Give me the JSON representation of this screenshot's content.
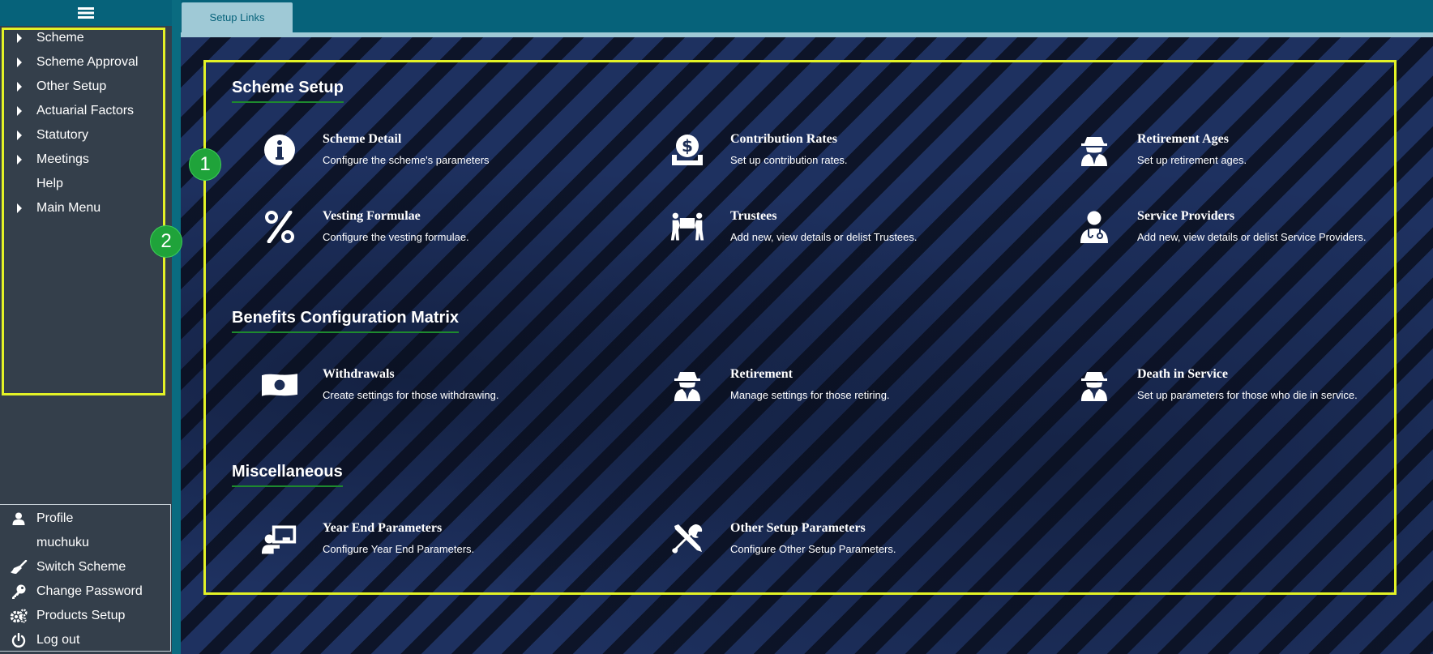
{
  "sidebar": {
    "menu_icon": "hamburger-icon",
    "items": [
      {
        "label": "Scheme",
        "expandable": true
      },
      {
        "label": "Scheme Approval",
        "expandable": true
      },
      {
        "label": "Other Setup",
        "expandable": true
      },
      {
        "label": "Actuarial Factors",
        "expandable": true
      },
      {
        "label": "Statutory",
        "expandable": true
      },
      {
        "label": "Meetings",
        "expandable": true
      },
      {
        "label": "Help",
        "expandable": false
      },
      {
        "label": "Main Menu",
        "expandable": true
      }
    ],
    "user_menu": [
      {
        "label": "Profile",
        "icon": "user-icon"
      },
      {
        "label": "muchuku",
        "icon": ""
      },
      {
        "label": "Switch Scheme",
        "icon": "broom-icon"
      },
      {
        "label": "Change Password",
        "icon": "key-icon"
      },
      {
        "label": "Products Setup",
        "icon": "gears-icon"
      },
      {
        "label": "Log out",
        "icon": "power-icon"
      }
    ]
  },
  "tabs": [
    {
      "label": "Setup Links",
      "active": true
    }
  ],
  "sections": [
    {
      "title": "Scheme Setup",
      "items": [
        {
          "title": "Scheme Detail",
          "description": "Configure the scheme's parameters",
          "icon": "info-circle-icon"
        },
        {
          "title": "Contribution Rates",
          "description": "Set up contribution rates.",
          "icon": "money-bag-icon"
        },
        {
          "title": "Retirement Ages",
          "description": "Set up retirement ages.",
          "icon": "user-secret-icon"
        },
        {
          "title": "Vesting Formulae",
          "description": "Configure the vesting formulae.",
          "icon": "percent-icon"
        },
        {
          "title": "Trustees",
          "description": "Add new, view details or delist Trustees.",
          "icon": "people-carry-icon"
        },
        {
          "title": "Service Providers",
          "description": "Add new, view details or delist Service Providers.",
          "icon": "doctor-icon"
        }
      ]
    },
    {
      "title": "Benefits Configuration Matrix",
      "items": [
        {
          "title": "Withdrawals",
          "description": "Create settings for those withdrawing.",
          "icon": "money-bill-icon"
        },
        {
          "title": "Retirement",
          "description": "Manage settings for those retiring.",
          "icon": "user-secret-icon"
        },
        {
          "title": "Death in Service",
          "description": "Set up parameters for those who die in service.",
          "icon": "user-secret-icon"
        }
      ]
    },
    {
      "title": "Miscellaneous",
      "items": [
        {
          "title": "Year End Parameters",
          "description": "Configure Year End Parameters.",
          "icon": "chalkboard-teacher-icon"
        },
        {
          "title": "Other Setup Parameters",
          "description": "Configure Other Setup Parameters.",
          "icon": "tools-icon"
        }
      ]
    }
  ],
  "annotations": [
    {
      "label": "1"
    },
    {
      "label": "2"
    }
  ],
  "colors": {
    "sidebar_bg": "#343f4b",
    "topbar_bg": "#06627a",
    "tab_bg": "#9fc9d6",
    "highlight": "#e3f226",
    "badge": "#1fa33a",
    "section_underline": "#1e8a2e"
  }
}
